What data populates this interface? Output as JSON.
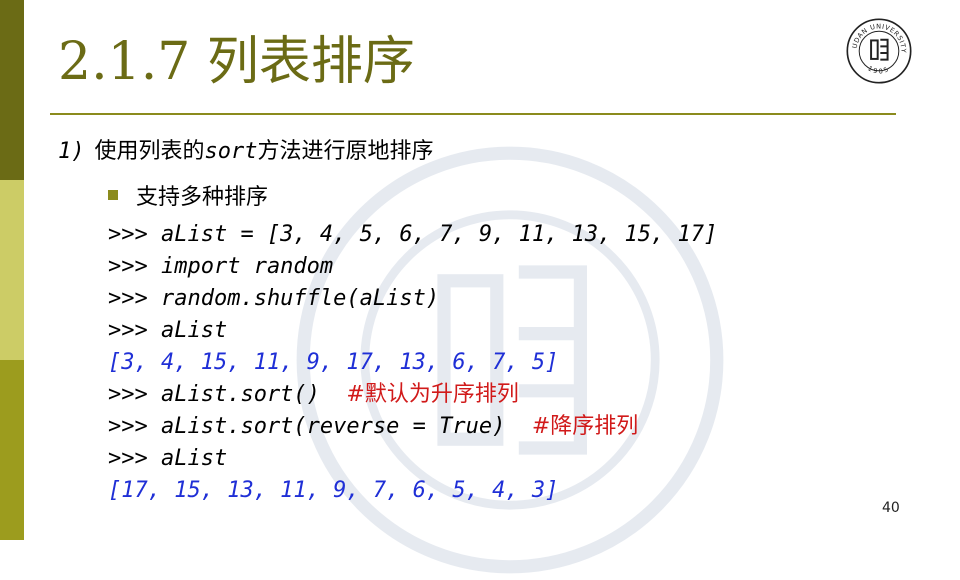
{
  "slide": {
    "title": "2.1.7 列表排序",
    "point_number": "1)",
    "point_text_pre": "使用列表的",
    "point_keyword": "sort",
    "point_text_post": "方法进行原地排序",
    "bullet": "支持多种排序",
    "code_lines": [
      {
        "kind": "cmd",
        "text": ">>> aList = [3, 4, 5, 6, 7, 9, 11, 13, 15, 17]",
        "comment": ""
      },
      {
        "kind": "cmd",
        "text": ">>> import random",
        "comment": ""
      },
      {
        "kind": "cmd",
        "text": ">>> random.shuffle(aList)",
        "comment": ""
      },
      {
        "kind": "cmd",
        "text": ">>> aList",
        "comment": ""
      },
      {
        "kind": "out",
        "text": "[3, 4, 15, 11, 9, 17, 13, 6, 7, 5]",
        "comment": ""
      },
      {
        "kind": "cmd",
        "text": ">>> aList.sort()  ",
        "comment": "#默认为升序排列"
      },
      {
        "kind": "cmd",
        "text": ">>> aList.sort(reverse = True)  ",
        "comment": "#降序排列"
      },
      {
        "kind": "cmd",
        "text": ">>> aList",
        "comment": ""
      },
      {
        "kind": "out",
        "text": "[17, 15, 13, 11, 9, 7, 6, 5, 4, 3]",
        "comment": ""
      }
    ],
    "page_number": "40"
  },
  "logo": {
    "arc_text": "FUDAN UNIVERSITY",
    "year": "1905"
  },
  "colors": {
    "strip_dark": "#6b6b15",
    "strip_light": "#cccc66",
    "strip_mid": "#9c9c1e",
    "title": "#6b6b15",
    "output": "#1f2fd6",
    "comment": "#d11a1a"
  }
}
